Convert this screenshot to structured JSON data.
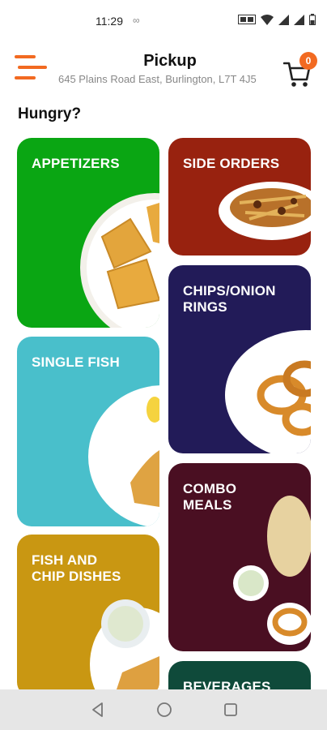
{
  "status_bar": {
    "time": "11:29",
    "infinity": "∞"
  },
  "header": {
    "title": "Pickup",
    "address": "645 Plains Road East, Burlington, L7T 4J5",
    "cart_count": "0",
    "accent_color": "#f26a21"
  },
  "greeting": "Hungry?",
  "categories": [
    {
      "label": "APPETIZERS",
      "color": "#0aa613"
    },
    {
      "label": "SIDE ORDERS",
      "color": "#98220f"
    },
    {
      "label": "CHIPS/ONION\nRINGS",
      "color": "#221b58"
    },
    {
      "label": "SINGLE FISH",
      "color": "#49bfcb"
    },
    {
      "label": "COMBO\nMEALS",
      "color": "#4a0f22"
    },
    {
      "label": "FISH AND\nCHIP DISHES",
      "color": "#c99712"
    },
    {
      "label": "BEVERAGES",
      "color": "#0f4a3a"
    }
  ],
  "nav": {
    "back_icon": "back-triangle",
    "home_icon": "home-circle",
    "recents_icon": "recents-square"
  }
}
